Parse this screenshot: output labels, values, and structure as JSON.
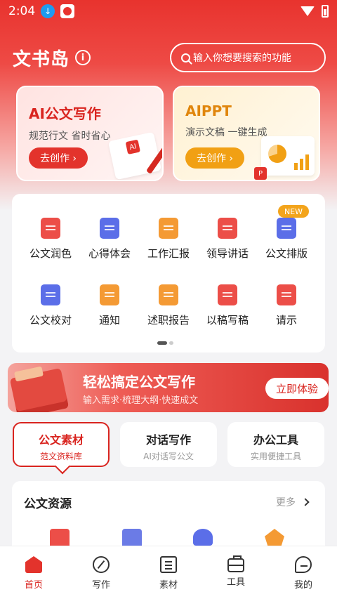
{
  "status_bar": {
    "time": "2:04"
  },
  "header": {
    "brand": "文书岛",
    "info_glyph": "i",
    "search_placeholder": "输入你想要搜索的功能"
  },
  "features": [
    {
      "title": "AI公文写作",
      "subtitle": "规范行文 省时省心",
      "button": "去创作 ›",
      "illustration_badge": "AI"
    },
    {
      "title": "AIPPT",
      "subtitle": "演示文稿 一键生成",
      "button": "去创作 ›",
      "illustration_badge": "P"
    }
  ],
  "grid": {
    "new_badge": "NEW",
    "items": [
      {
        "label": "公文润色",
        "icon": "polish-icon",
        "color": "red"
      },
      {
        "label": "心得体会",
        "icon": "notebook-heart-icon",
        "color": "blue"
      },
      {
        "label": "工作汇报",
        "icon": "report-icon",
        "color": "orange"
      },
      {
        "label": "领导讲话",
        "icon": "speech-bubble-icon",
        "color": "red"
      },
      {
        "label": "公文排版",
        "icon": "layout-icon",
        "color": "blue"
      },
      {
        "label": "公文校对",
        "icon": "proofread-icon",
        "color": "blue"
      },
      {
        "label": "通知",
        "icon": "notice-icon",
        "color": "orange"
      },
      {
        "label": "述职报告",
        "icon": "id-card-icon",
        "color": "orange"
      },
      {
        "label": "以稿写稿",
        "icon": "quill-icon",
        "color": "red"
      },
      {
        "label": "请示",
        "icon": "request-icon",
        "color": "red"
      }
    ],
    "page_count": 2,
    "current_page": 1
  },
  "banner": {
    "title": "轻松搞定公文写作",
    "subtitle": "输入需求·梳理大纲·快速成文",
    "button": "立即体验"
  },
  "tabs": [
    {
      "title": "公文素材",
      "subtitle": "范文资料库",
      "active": true
    },
    {
      "title": "对话写作",
      "subtitle": "AI对话写公文",
      "active": false
    },
    {
      "title": "办公工具",
      "subtitle": "实用便捷工具",
      "active": false
    }
  ],
  "resources": {
    "title": "公文资源",
    "more": "更多"
  },
  "bottom_nav": [
    {
      "label": "首页",
      "icon": "home-icon",
      "active": true
    },
    {
      "label": "写作",
      "icon": "pen-circle-icon",
      "active": false
    },
    {
      "label": "素材",
      "icon": "document-icon",
      "active": false
    },
    {
      "label": "工具",
      "icon": "briefcase-icon",
      "active": false
    },
    {
      "label": "我的",
      "icon": "profile-icon",
      "active": false
    }
  ],
  "colors": {
    "primary": "#e3332c",
    "accent_orange": "#f1a014",
    "accent_blue": "#5b6ee8"
  }
}
